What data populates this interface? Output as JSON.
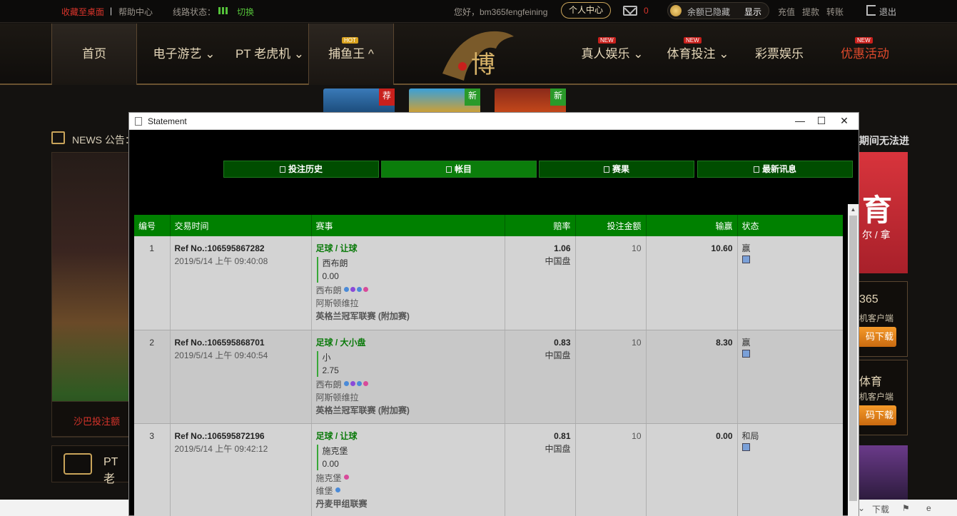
{
  "topbar": {
    "bookmark": "收藏至桌面",
    "sep": "|",
    "help": "帮助中心",
    "line_status": "线路状态：",
    "switch": "切换",
    "greeting": "您好，bm365fengfeining",
    "member_center": "个人中心",
    "mail_count": "0",
    "balance_hidden": "余额已隐藏",
    "show": "显示",
    "deposit": "充值",
    "withdraw": "提款",
    "transfer": "转账",
    "logout": "退出"
  },
  "nav": {
    "items": [
      "首页",
      "电子游艺",
      "PT 老虎机",
      "捕鱼王",
      "真人娱乐",
      "体育投注",
      "彩票娱乐",
      "优惠活动"
    ],
    "hot_badge": "HOT",
    "new_badge": "NEW",
    "logo_text": "博"
  },
  "game_thumbs": {
    "tags": [
      "荐",
      "新",
      "新"
    ]
  },
  "sidebar": {
    "news": "NEWS 公告：",
    "banner_caption": "沙巴投注额",
    "pt_label": "PT 老"
  },
  "right": {
    "notice": "期间无法进",
    "banner_big": "育",
    "banner_small": "尔 / 拿",
    "dl1_title": "365",
    "dl1_sub": "机客户端",
    "dl1_btn": "码下载",
    "dl2_title": "体育",
    "dl2_sub": "机客户端",
    "dl2_btn": "码下载"
  },
  "bottom_bar": {
    "download": "下载"
  },
  "window": {
    "title": "Statement",
    "minimize": "—",
    "maximize": "☐",
    "close": "✕",
    "tabs": [
      "投注历史",
      "帐目",
      "赛果",
      "最新讯息"
    ],
    "columns": [
      "编号",
      "交易时间",
      "赛事",
      "赔率",
      "投注金额",
      "输赢",
      "状态"
    ],
    "rows": [
      {
        "no": "1",
        "ref": "Ref No.:106595867282",
        "time": "2019/5/14 上午 09:40:08",
        "sport": "足球 / 让球",
        "pick": "西布朗",
        "handicap": "0.00",
        "home": "西布朗",
        "away": "阿斯顿维拉",
        "league": "英格兰冠军联赛 (附加赛)",
        "odds": "1.06",
        "odds_type": "中国盘",
        "amount": "10",
        "winloss": "10.60",
        "status": "赢"
      },
      {
        "no": "2",
        "ref": "Ref No.:106595868701",
        "time": "2019/5/14 上午 09:40:54",
        "sport": "足球 / 大小盘",
        "pick": "小",
        "handicap": "2.75",
        "home": "西布朗",
        "away": "阿斯顿维拉",
        "league": "英格兰冠军联赛 (附加赛)",
        "odds": "0.83",
        "odds_type": "中国盘",
        "amount": "10",
        "winloss": "8.30",
        "status": "赢"
      },
      {
        "no": "3",
        "ref": "Ref No.:106595872196",
        "time": "2019/5/14 上午 09:42:12",
        "sport": "足球 / 让球",
        "pick": "施克堡",
        "handicap": "0.00",
        "home": "施克堡",
        "away": "维堡",
        "league": "丹麦甲组联赛",
        "odds": "0.81",
        "odds_type": "中国盘",
        "amount": "10",
        "winloss": "0.00",
        "status": "和局"
      }
    ]
  },
  "colors": {
    "header_green": "#008000",
    "tab_green": "#004d00",
    "sport_green": "#0a7a0a",
    "accent_red": "#d9342b",
    "gold": "#c9a45a"
  }
}
